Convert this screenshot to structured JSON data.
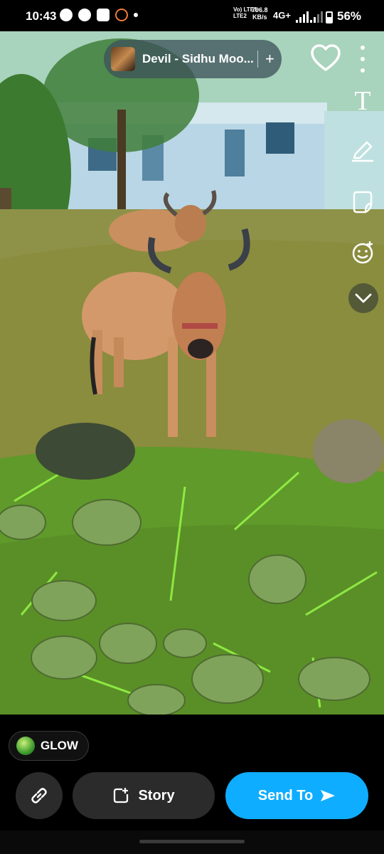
{
  "status_bar": {
    "time": "10:43",
    "network_type_top": "Vo) LTE1",
    "network_type_bottom": "LTE2",
    "speed_value": "796.8",
    "speed_unit": "KB/s",
    "mobile_data": "4G+",
    "battery_percent": "56%",
    "notification_icons": [
      "snapchat-icon",
      "whatsapp-icon",
      "youtube-icon",
      "settings-ring-icon"
    ]
  },
  "top_overlay": {
    "music_title": "Devil - Sidhu Moo...",
    "add_label": "+",
    "text_tool": "T",
    "tools": [
      "text-tool-icon",
      "pen-icon",
      "sticker-icon",
      "emoji-icon",
      "chevron-down-icon"
    ]
  },
  "bottom_bar": {
    "filter_label": "GLOW",
    "story_label": "Story",
    "send_label": "Send To"
  },
  "colors": {
    "send_button": "#0fadff",
    "dark_button": "#2b2b2b",
    "background": "#000000"
  }
}
